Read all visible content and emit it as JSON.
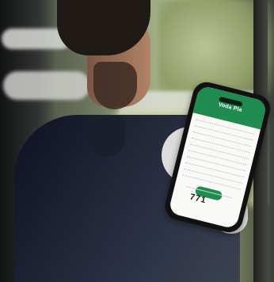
{
  "screen": {
    "app_title": "Voda Pla",
    "button_label": "",
    "number_readout": "771"
  }
}
